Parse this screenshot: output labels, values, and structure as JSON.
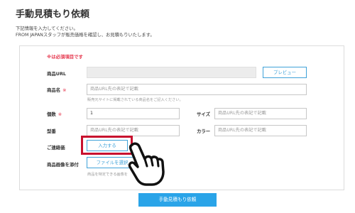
{
  "page": {
    "title": "手動見積もり依頼",
    "intro_line1": "下記情報を入力してください。",
    "intro_line2": "FROM JAPANスタッフが販売価格を確認し、お見積もりいたします。"
  },
  "form": {
    "required_note": "※は必須項目です",
    "required_mark": "※",
    "product_url": {
      "label": "商品URL",
      "value": "",
      "preview_button": "プレビュー"
    },
    "product_name": {
      "label": "商品名",
      "placeholder": "商品URL先の表記で記載",
      "hint": "販売元サイトに掲載されている商品名をご記入ください。"
    },
    "quantity": {
      "label": "個数",
      "value": "1"
    },
    "size": {
      "label": "サイズ",
      "placeholder": "商品URL先の表記で記載"
    },
    "model": {
      "label": "型番",
      "placeholder": "商品URL先の表記で記載"
    },
    "color": {
      "label": "カラー",
      "placeholder": "商品URL先の表記で記載"
    },
    "price": {
      "label": "ご連絡価",
      "button": "入力する"
    },
    "image": {
      "label": "商品画像を添付",
      "button": "ファイルを選択",
      "hint": "商品を特定できる画像を"
    },
    "submit_label": "手動見積もり依頼"
  },
  "colors": {
    "accent": "#2aa4e8",
    "outline": "#3fa2d9",
    "required": "#e5334a",
    "highlight": "#c8102e"
  },
  "icons": {
    "pointer": "pointing-hand-icon"
  }
}
